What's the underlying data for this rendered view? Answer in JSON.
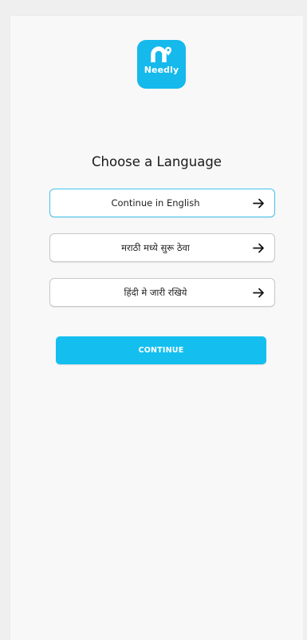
{
  "app": {
    "logo_text": "Needly",
    "logo_icon": "needly-map-pin-icon",
    "brand_color": "#15b9ec"
  },
  "main": {
    "heading": "Choose a Language",
    "languages": [
      {
        "label": "Continue in English",
        "selected": true,
        "icon": "arrow-right-icon"
      },
      {
        "label": "मराठी मध्ये सुरू ठेवा",
        "selected": false,
        "icon": "arrow-right-icon"
      },
      {
        "label": "हिंदी मे जारी रखिये",
        "selected": false,
        "icon": "arrow-right-icon"
      }
    ],
    "continue_label": "CONTINUE",
    "selected_border_color": "#44c4ee",
    "button_color": "#14bff0"
  }
}
